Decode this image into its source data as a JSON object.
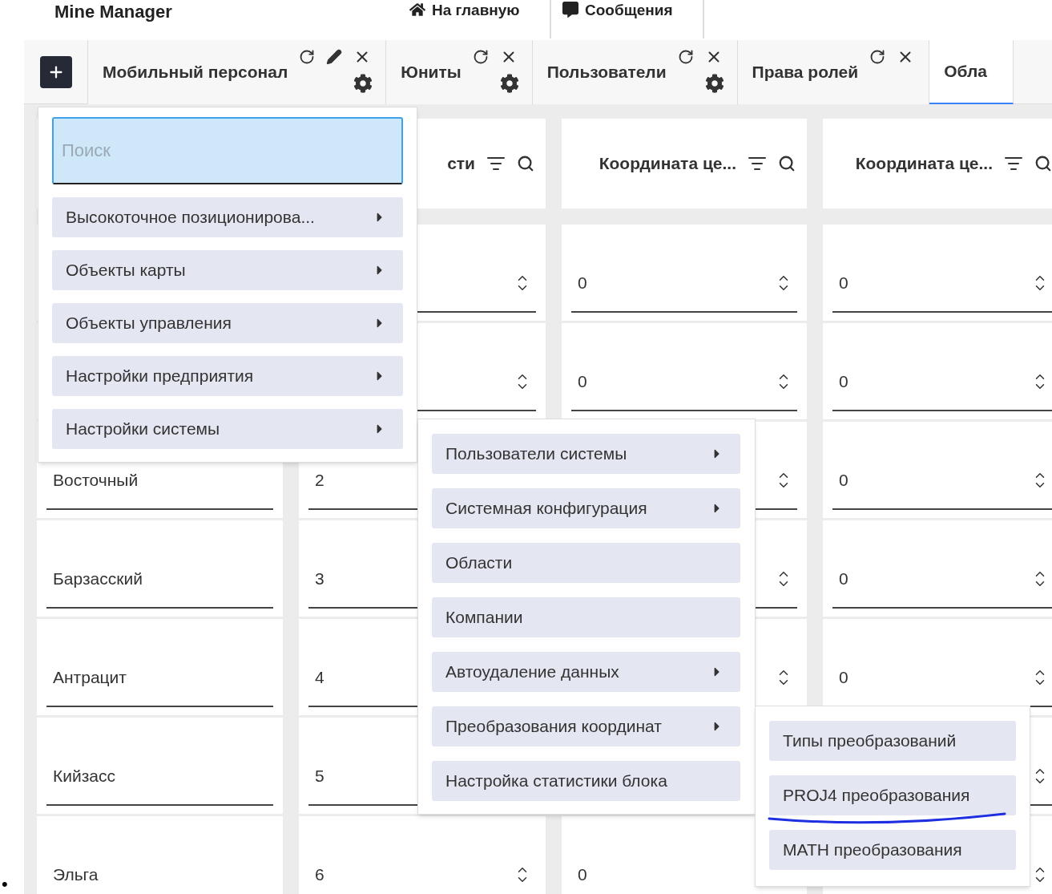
{
  "header": {
    "app_title": "Mine Manager",
    "nav": [
      {
        "label": "На главную",
        "kind": "home"
      },
      {
        "label": "Сообщения",
        "kind": "chat"
      }
    ]
  },
  "tabs": [
    {
      "label": "Мобильный персонал",
      "selected": false,
      "refreshable": true,
      "editable": true,
      "closable": true,
      "configurable": true
    },
    {
      "label": "Юниты",
      "selected": false,
      "refreshable": true,
      "editable": false,
      "closable": true,
      "configurable": true
    },
    {
      "label": "Пользователи",
      "selected": false,
      "refreshable": true,
      "editable": false,
      "closable": true,
      "configurable": true
    },
    {
      "label": "Права ролей",
      "selected": false,
      "refreshable": true,
      "editable": false,
      "closable": true,
      "configurable": false
    },
    {
      "label": "Обла",
      "selected": true,
      "refreshable": false,
      "editable": false,
      "closable": false,
      "configurable": false
    }
  ],
  "table": {
    "columns": [
      {
        "kind": "text"
      },
      {
        "label": "сти",
        "kind": "number"
      },
      {
        "label": "Координата це...",
        "kind": "number"
      },
      {
        "label": "Координата це...",
        "kind": "number"
      }
    ],
    "rows": [
      {
        "cells": [
          null,
          null,
          "0",
          "0"
        ]
      },
      {
        "cells": [
          null,
          null,
          "0",
          "0"
        ]
      },
      {
        "cells": [
          "Восточный",
          "2",
          null,
          "0"
        ]
      },
      {
        "cells": [
          "Барзасский",
          "3",
          null,
          "0"
        ]
      },
      {
        "cells": [
          "Антрацит",
          "4",
          null,
          "0"
        ]
      },
      {
        "cells": [
          "Кийзасс",
          "5",
          null,
          null
        ]
      },
      {
        "cells": [
          "Эльга",
          "6",
          "0",
          null
        ]
      }
    ]
  },
  "menu": {
    "search": {
      "placeholder": "Поиск"
    },
    "items": [
      {
        "label": "Высокоточное позиционирова...",
        "has_submenu": true
      },
      {
        "label": "Объекты карты",
        "has_submenu": true
      },
      {
        "label": "Объекты управления",
        "has_submenu": true
      },
      {
        "label": "Настройки предприятия",
        "has_submenu": true
      },
      {
        "label": "Настройки системы",
        "has_submenu": true
      }
    ]
  },
  "submenu": {
    "items": [
      {
        "label": "Пользователи системы",
        "has_submenu": true
      },
      {
        "label": "Системная конфигурация",
        "has_submenu": true
      },
      {
        "label": "Области",
        "has_submenu": false
      },
      {
        "label": "Компании",
        "has_submenu": false
      },
      {
        "label": "Автоудаление данных",
        "has_submenu": true
      },
      {
        "label": "Преобразования координат",
        "has_submenu": true
      },
      {
        "label": "Настройка статистики блока",
        "has_submenu": false
      }
    ]
  },
  "submenu2": {
    "items": [
      {
        "label": "Типы преобразований",
        "has_submenu": false,
        "marked": false
      },
      {
        "label": "PROJ4 преобразования",
        "has_submenu": false,
        "marked": true
      },
      {
        "label": "MATH преобразования",
        "has_submenu": false,
        "marked": false
      }
    ]
  },
  "bullet": "•"
}
